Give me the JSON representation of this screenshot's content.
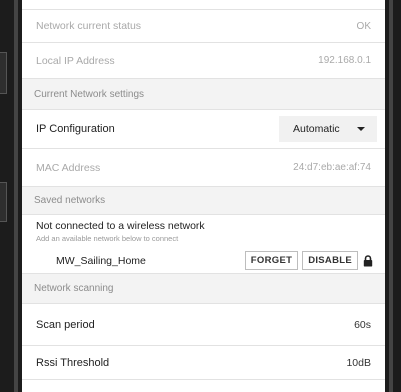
{
  "rows": {
    "network_status": {
      "label": "Network current status",
      "value": "OK"
    },
    "local_ip": {
      "label": "Local IP Address",
      "value": "192.168.0.1"
    },
    "ip_config": {
      "label": "IP Configuration",
      "value": "Automatic"
    },
    "mac": {
      "label": "MAC Address",
      "value": "24:d7:eb:ae:af:74"
    },
    "scan_period": {
      "label": "Scan period",
      "value": "60s"
    },
    "rssi": {
      "label": "Rssi Threshold",
      "value": "10dB"
    }
  },
  "sections": {
    "current_network": "Current Network settings",
    "saved_networks": "Saved networks",
    "network_scanning": "Network scanning"
  },
  "saved": {
    "status_title": "Not connected to a wireless network",
    "status_hint": "Add an available network below to connect",
    "network_name": "MW_Sailing_Home",
    "forget_label": "FORGET",
    "disable_label": "DISABLE",
    "lock_icon": "lock-icon"
  },
  "colors": {
    "frame": "#1c1c1c",
    "section_bg": "#f3f3f3",
    "dim_text": "#a9a9a9"
  }
}
